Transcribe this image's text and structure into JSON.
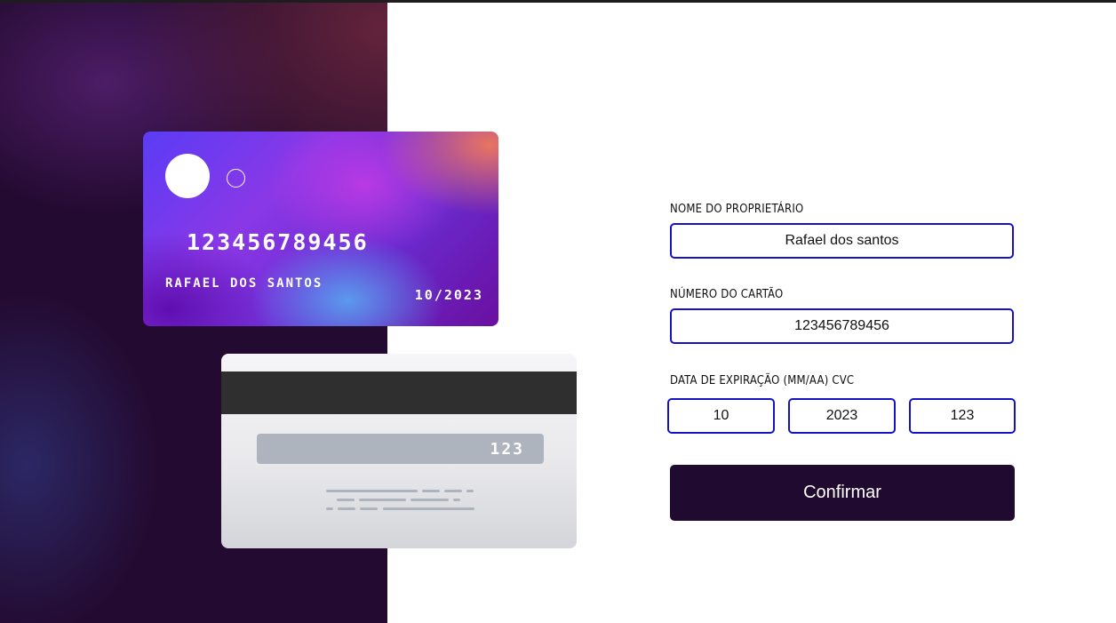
{
  "card_front": {
    "number": "123456789456",
    "holder": "RAFAEL DOS SANTOS",
    "expiry": "10/2023"
  },
  "card_back": {
    "cvc": "123"
  },
  "form": {
    "owner_label": "NOME DO PROPRIETÁRIO",
    "owner_value": "Rafael dos santos",
    "number_label": "NÚMERO DO CARTÃO",
    "number_value": "123456789456",
    "expiry_label": "DATA DE EXPIRAÇÃO (MM/AA) CVC",
    "month_value": "10",
    "year_value": "2023",
    "cvc_value": "123",
    "confirm_label": "Confirmar"
  },
  "colors": {
    "accent_border": "#1313c4",
    "button_bg": "#210a2f",
    "panel_bg": "#230a30"
  }
}
